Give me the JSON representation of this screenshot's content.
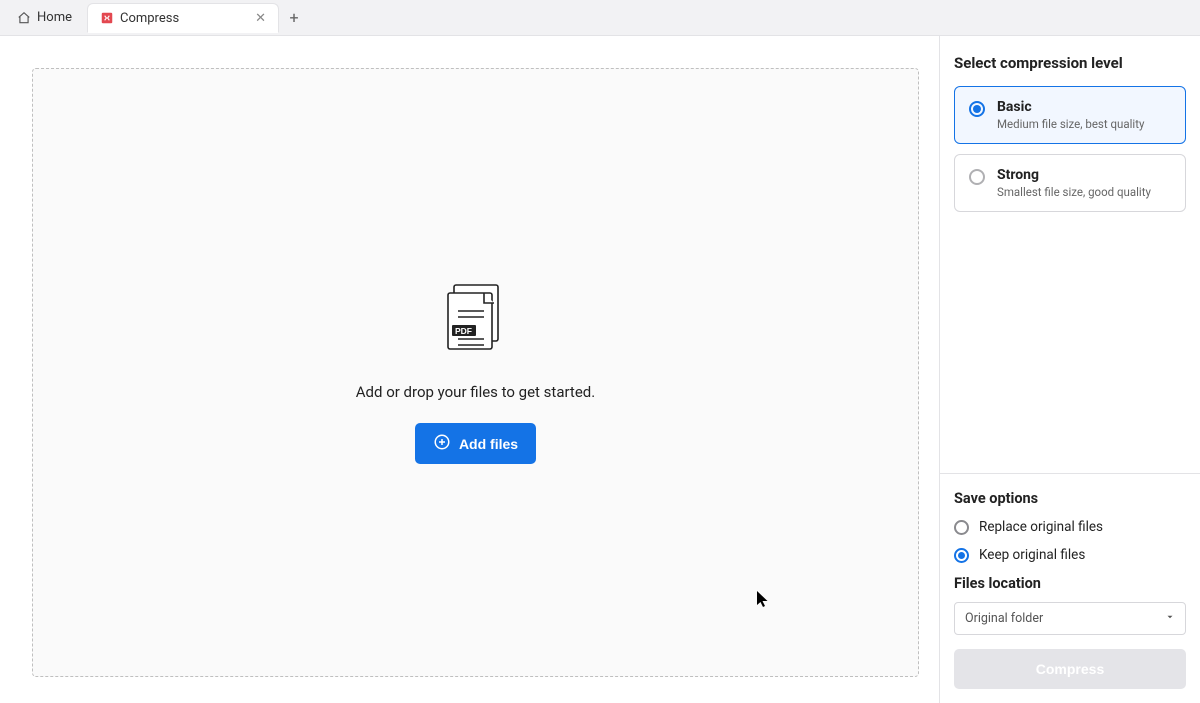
{
  "tabs": {
    "home": "Home",
    "active": "Compress"
  },
  "dropzone": {
    "prompt": "Add or drop your files to get started.",
    "add_button": "Add files"
  },
  "sidebar": {
    "compression_title": "Select compression level",
    "levels": [
      {
        "title": "Basic",
        "subtitle": "Medium file size, best quality",
        "selected": true
      },
      {
        "title": "Strong",
        "subtitle": "Smallest file size, good quality",
        "selected": false
      }
    ],
    "save": {
      "title": "Save options",
      "replace": "Replace original files",
      "keep": "Keep original files",
      "selected": "keep"
    },
    "location": {
      "title": "Files location",
      "value": "Original folder"
    },
    "compress_button": "Compress"
  }
}
